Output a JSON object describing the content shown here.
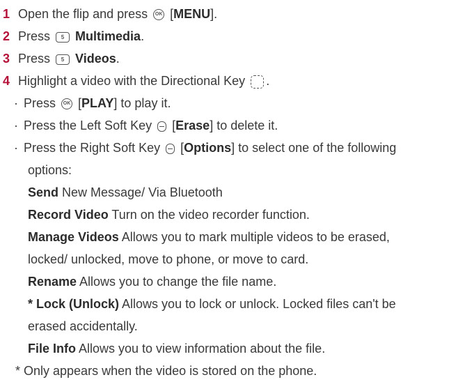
{
  "steps": [
    {
      "num": "1",
      "pre": "Open the flip and press",
      "key": "OK",
      "after": " [",
      "bold": "MENU",
      "post": "]."
    },
    {
      "num": "2",
      "pre": "Press",
      "key": "5",
      "bold": "Multimedia",
      "post": "."
    },
    {
      "num": "3",
      "pre": "Press",
      "key": "5",
      "bold": "Videos",
      "post": "."
    },
    {
      "num": "4",
      "pre": "Highlight a video with the Directional Key",
      "post": "."
    }
  ],
  "bullets": [
    {
      "pre": "Press",
      "key": "OK",
      "after": " [",
      "bold": "PLAY",
      "post": "] to play it."
    },
    {
      "pre": "Press the Left Soft Key",
      "after": " [",
      "bold": "Erase",
      "post": "] to delete it."
    },
    {
      "pre": "Press the Right Soft Key",
      "after": " [",
      "bold": "Options",
      "post": "] to select one of the following",
      "cont": "options:"
    }
  ],
  "options": [
    {
      "bold": "Send",
      "text": " New Message/ Via Bluetooth"
    },
    {
      "bold": "Record Video",
      "text": " Turn on the video recorder function."
    },
    {
      "bold": "Manage Videos",
      "text": " Allows you to mark multiple videos to be erased,",
      "cont": "locked/ unlocked, move to phone, or move to card."
    },
    {
      "bold": "Rename",
      "text": " Allows you to change the file name."
    },
    {
      "bold": "* Lock (Unlock)",
      "text": " Allows you to lock or unlock. Locked files can't be",
      "cont": "erased accidentally."
    },
    {
      "bold": "File Info",
      "text": " Allows you to view information about the file."
    }
  ],
  "footnote": "* Only appears when the video is stored on the phone.",
  "bullet_char": "·",
  "colors": {
    "accent": "#b5123a",
    "text": "#3a3a3a"
  },
  "icons": {
    "ok": "ok-key-icon",
    "five": "five-key-icon",
    "soft": "soft-key-icon",
    "dir": "directional-key-icon"
  }
}
